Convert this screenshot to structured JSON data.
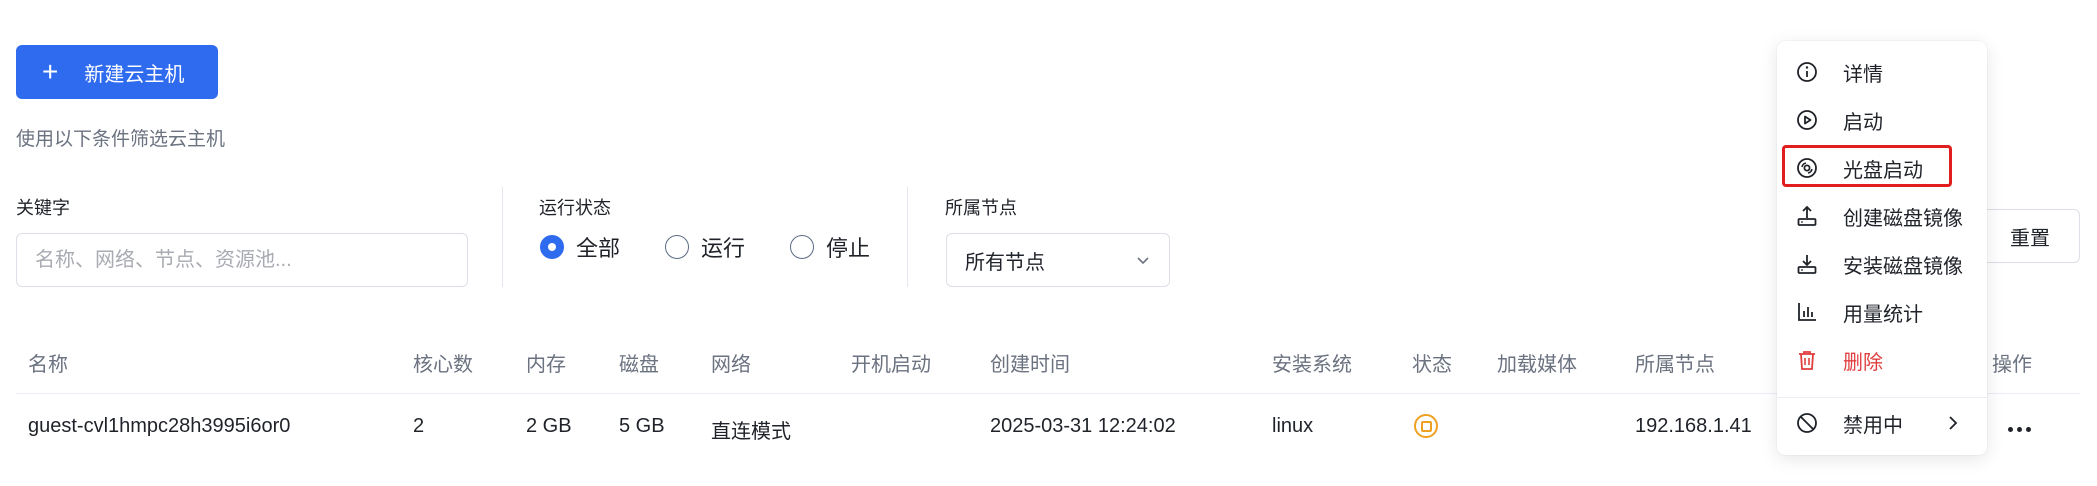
{
  "toolbar": {
    "create_label": "新建云主机"
  },
  "filters": {
    "hint": "使用以下条件筛选云主机",
    "keyword": {
      "label": "关键字",
      "placeholder": "名称、网络、节点、资源池...",
      "value": ""
    },
    "run_state": {
      "label": "运行状态",
      "options": [
        {
          "label": "全部",
          "checked": true
        },
        {
          "label": "运行",
          "checked": false
        },
        {
          "label": "停止",
          "checked": false
        }
      ]
    },
    "node": {
      "label": "所属节点",
      "selected": "所有节点"
    },
    "reset_label": "重置"
  },
  "table": {
    "columns": [
      "名称",
      "核心数",
      "内存",
      "磁盘",
      "网络",
      "开机启动",
      "创建时间",
      "安装系统",
      "状态",
      "加载媒体",
      "所属节点",
      "操作"
    ],
    "rows": [
      {
        "name": "guest-cvl1hmpc28h3995i6or0",
        "cores": "2",
        "memory": "2 GB",
        "disk": "5 GB",
        "network": "直连模式",
        "autostart": "",
        "created": "2025-03-31 12:24:02",
        "os": "linux",
        "status_icon": "stopped-status-icon",
        "media": "",
        "node": "192.168.1.41"
      }
    ]
  },
  "action_menu": {
    "items": [
      {
        "label": "详情",
        "icon": "info-icon"
      },
      {
        "label": "启动",
        "icon": "play-icon"
      },
      {
        "label": "光盘启动",
        "icon": "disc-icon",
        "highlighted": true
      },
      {
        "label": "创建磁盘镜像",
        "icon": "upload-drive-icon"
      },
      {
        "label": "安装磁盘镜像",
        "icon": "download-drive-icon"
      },
      {
        "label": "用量统计",
        "icon": "bar-chart-icon"
      },
      {
        "label": "删除",
        "icon": "trash-icon",
        "danger": true
      }
    ],
    "footer": {
      "label": "禁用中",
      "icon": "ban-icon"
    }
  },
  "colors": {
    "primary": "#2f6bef",
    "danger": "#e03e3e",
    "highlight_border": "#e11d1d",
    "status_stopped": "#f0a020"
  }
}
